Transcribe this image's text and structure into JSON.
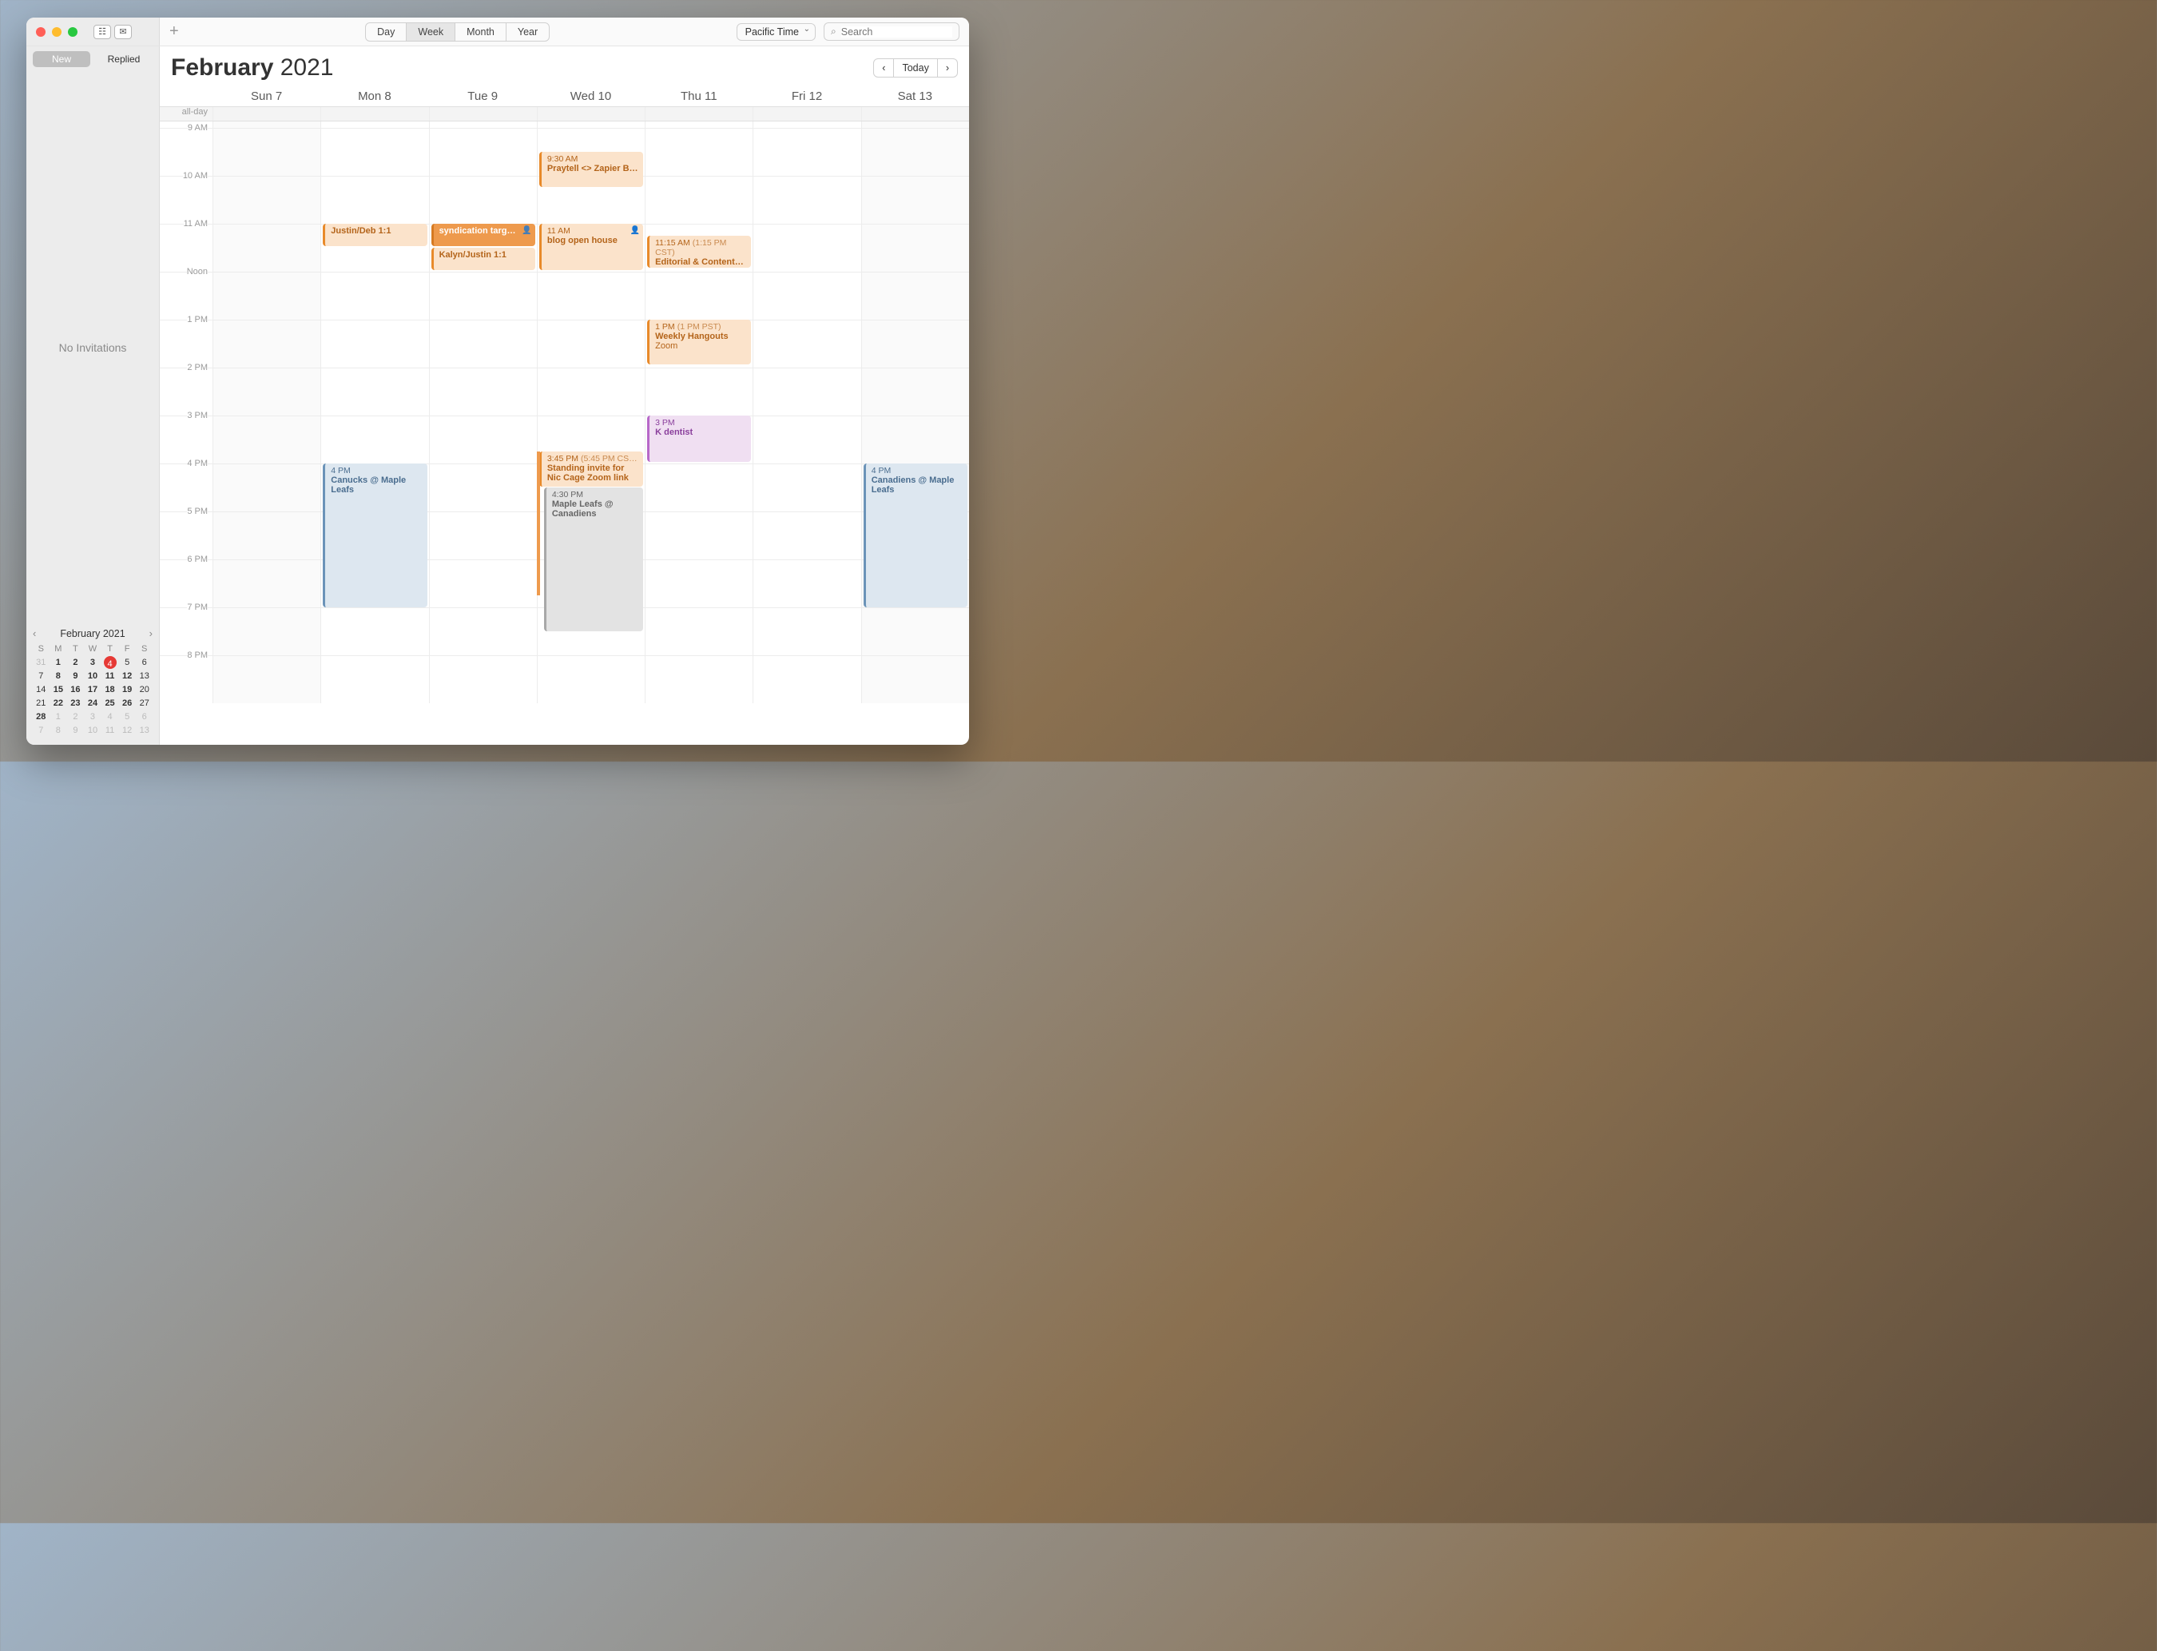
{
  "toolbar": {
    "views": {
      "day": "Day",
      "week": "Week",
      "month": "Month",
      "year": "Year",
      "active": "Week"
    },
    "timezone": "Pacific Time",
    "search_placeholder": "Search",
    "plus": "+"
  },
  "sidebar": {
    "tabs": {
      "new": "New",
      "replied": "Replied"
    },
    "empty": "No Invitations"
  },
  "header": {
    "month": "February",
    "year": "2021",
    "today_btn": "Today",
    "prev": "‹",
    "next": "›"
  },
  "dayHeaders": [
    "Sun 7",
    "Mon 8",
    "Tue 9",
    "Wed 10",
    "Thu 11",
    "Fri 12",
    "Sat 13"
  ],
  "allday_label": "all-day",
  "hours": [
    "9 AM",
    "10 AM",
    "11 AM",
    "Noon",
    "1 PM",
    "2 PM",
    "3 PM",
    "4 PM",
    "5 PM",
    "6 PM",
    "7 PM",
    "8 PM"
  ],
  "events": {
    "mon": {
      "justin_deb": {
        "title": "Justin/Deb 1:1"
      },
      "canucks": {
        "time": "4 PM",
        "title": "Canucks @ Maple Leafs"
      }
    },
    "tue": {
      "syndication": {
        "title": "syndication targ…"
      },
      "kalyn": {
        "title": "Kalyn/Justin 1:1"
      }
    },
    "wed": {
      "praytell": {
        "time": "9:30 AM",
        "title": "Praytell <> Zapier B…"
      },
      "blog": {
        "time": "11 AM",
        "title": "blog open house"
      },
      "standing": {
        "time": "3:45 PM",
        "tz": "(5:45 PM CS…",
        "title": "Standing invite for Nic Cage Zoom link"
      },
      "leafs": {
        "time": "4:30 PM",
        "title": "Maple Leafs @ Canadiens"
      }
    },
    "thu": {
      "editorial": {
        "time": "11:15 AM",
        "tz": "(1:15 PM CST)",
        "title": "Editorial & Content…"
      },
      "hangouts": {
        "time": "1 PM",
        "tz": "(1 PM PST)",
        "title": "Weekly Hangouts",
        "loc": "Zoom"
      },
      "dentist": {
        "time": "3 PM",
        "title": "K dentist"
      }
    },
    "sat": {
      "canadiens": {
        "time": "4 PM",
        "title": "Canadiens @ Maple Leafs"
      }
    }
  },
  "miniCal": {
    "title": "February 2021",
    "prev": "‹",
    "next": "›",
    "dayHeaders": [
      "S",
      "M",
      "T",
      "W",
      "T",
      "F",
      "S"
    ],
    "weeks": [
      [
        {
          "d": "31",
          "off": true
        },
        {
          "d": "1",
          "bold": true
        },
        {
          "d": "2",
          "bold": true
        },
        {
          "d": "3",
          "bold": true
        },
        {
          "d": "4",
          "today": true
        },
        {
          "d": "5"
        },
        {
          "d": "6"
        }
      ],
      [
        {
          "d": "7"
        },
        {
          "d": "8",
          "bold": true
        },
        {
          "d": "9",
          "bold": true
        },
        {
          "d": "10",
          "bold": true
        },
        {
          "d": "11",
          "bold": true
        },
        {
          "d": "12",
          "bold": true
        },
        {
          "d": "13"
        }
      ],
      [
        {
          "d": "14"
        },
        {
          "d": "15",
          "bold": true
        },
        {
          "d": "16",
          "bold": true
        },
        {
          "d": "17",
          "bold": true
        },
        {
          "d": "18",
          "bold": true
        },
        {
          "d": "19",
          "bold": true
        },
        {
          "d": "20"
        }
      ],
      [
        {
          "d": "21"
        },
        {
          "d": "22",
          "bold": true
        },
        {
          "d": "23",
          "bold": true
        },
        {
          "d": "24",
          "bold": true
        },
        {
          "d": "25",
          "bold": true
        },
        {
          "d": "26",
          "bold": true
        },
        {
          "d": "27"
        }
      ],
      [
        {
          "d": "28",
          "bold": true
        },
        {
          "d": "1",
          "off": true
        },
        {
          "d": "2",
          "off": true
        },
        {
          "d": "3",
          "off": true
        },
        {
          "d": "4",
          "off": true
        },
        {
          "d": "5",
          "off": true
        },
        {
          "d": "6",
          "off": true
        }
      ],
      [
        {
          "d": "7",
          "off": true
        },
        {
          "d": "8",
          "off": true
        },
        {
          "d": "9",
          "off": true
        },
        {
          "d": "10",
          "off": true
        },
        {
          "d": "11",
          "off": true
        },
        {
          "d": "12",
          "off": true
        },
        {
          "d": "13",
          "off": true
        }
      ]
    ]
  }
}
